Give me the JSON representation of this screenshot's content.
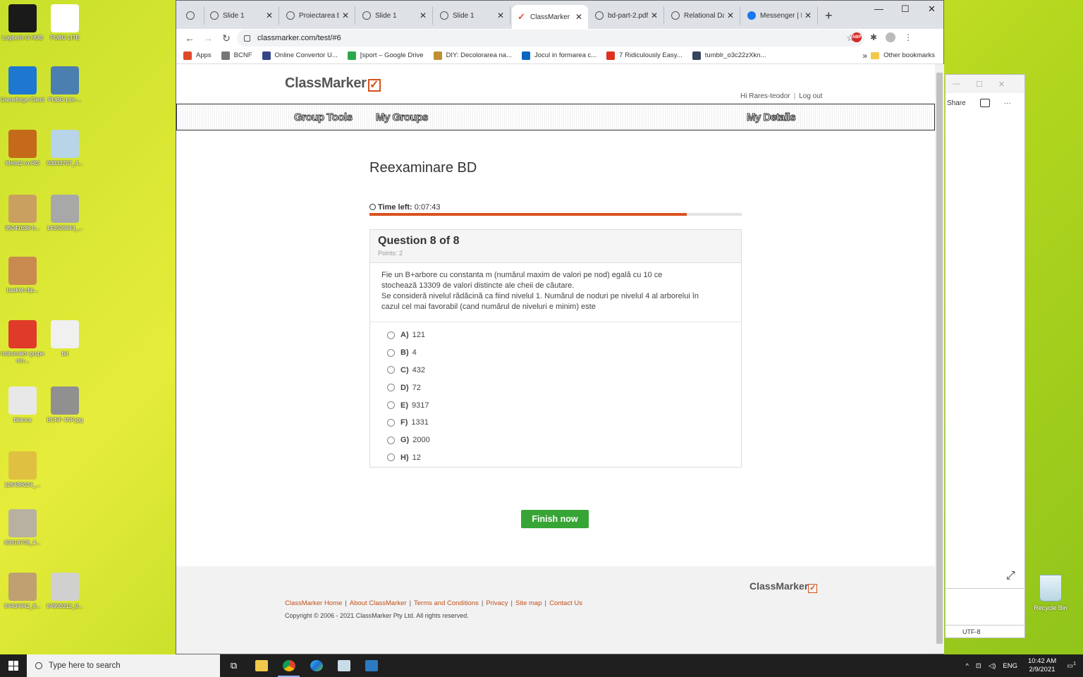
{
  "desktop": {
    "icons": [
      {
        "label": "Logitech G HUB",
        "color": "#1a1a1a"
      },
      {
        "label": "PUBG LITE",
        "color": "#ffffff"
      },
      {
        "label": "Gameforge Client",
        "color": "#1e78d2"
      },
      {
        "label": "PUBG-Lite-...",
        "color": "#4a7fb0"
      },
      {
        "label": "Metin2 ro-RO",
        "color": "#c46a1a"
      },
      {
        "label": "83933767_4...",
        "color": "#b8d4e8"
      },
      {
        "label": "95041636-h...",
        "color": "#c9a060"
      },
      {
        "label": "143509843_...",
        "color": "#a8a8a8"
      },
      {
        "label": "basket-clip...",
        "color": "#c98a50"
      },
      {
        "label": "",
        "color": "transparent"
      },
      {
        "label": "Indrumator grupe nm...",
        "color": "#e03a2a"
      },
      {
        "label": "bd",
        "color": "#f0f0f0"
      },
      {
        "label": "bilanca",
        "color": "#e8e8e8"
      },
      {
        "label": "BCNF 4NF.jpg",
        "color": "#909090"
      },
      {
        "label": "126486024_...",
        "color": "#e0c040"
      },
      {
        "label": "",
        "color": "transparent"
      },
      {
        "label": "83916708_4...",
        "color": "#b8b0a0"
      },
      {
        "label": "",
        "color": "transparent"
      },
      {
        "label": "84434842_8...",
        "color": "#c0a070"
      },
      {
        "label": "84950313_9...",
        "color": "#d0d0d0"
      }
    ],
    "recycle_bin": "Recycle Bin"
  },
  "side_window": {
    "share": "Share",
    "print_icon": "print-icon",
    "more": "···",
    "expand": "⤢",
    "encoding": "UTF-8"
  },
  "browser": {
    "tabs": [
      {
        "label": "",
        "icon": "globe-icon"
      },
      {
        "label": "Slide 1",
        "icon": "globe-icon"
      },
      {
        "label": "Proiectarea b",
        "icon": "globe-icon"
      },
      {
        "label": "Slide 1",
        "icon": "globe-icon"
      },
      {
        "label": "Slide 1",
        "icon": "globe-icon"
      },
      {
        "label": "ClassMarker",
        "icon": "classmarker-icon",
        "active": true
      },
      {
        "label": "bd-part-2.pdf",
        "icon": "globe-icon"
      },
      {
        "label": "Relational Da",
        "icon": "globe-icon"
      },
      {
        "label": "Messenger | F",
        "icon": "facebook-icon"
      }
    ],
    "new_tab": "+",
    "window_controls": {
      "minimize": "—",
      "maximize": "☐",
      "close": "✕"
    },
    "url": "classmarker.com/test/#6",
    "bookmarks": [
      {
        "label": "Apps",
        "color": "#e04a2a"
      },
      {
        "label": "BCNF",
        "color": "#777777"
      },
      {
        "label": "Online Convertor U...",
        "color": "#334488"
      },
      {
        "label": "[sport – Google Drive",
        "color": "#2aa84a"
      },
      {
        "label": "DIY: Decolorarea na...",
        "color": "#c09030"
      },
      {
        "label": "Jocul in formarea c...",
        "color": "#0a66c2"
      },
      {
        "label": "7 Ridiculously Easy...",
        "color": "#e03020"
      },
      {
        "label": "tumblr_o3c22zXkn...",
        "color": "#36465d"
      }
    ],
    "bookmarks_more": "»",
    "other_bookmarks": "Other bookmarks"
  },
  "page": {
    "logo": "ClassMarker",
    "greeting": "Hi Rares-teodor",
    "logout": "Log out",
    "nav": {
      "group_tools": "Group Tools",
      "my_groups": "My Groups",
      "my_details": "My Details"
    },
    "test_title": "Reexaminare BD",
    "time_label": "Time left:",
    "time_value": "0:07:43",
    "time_progress": 0.852,
    "question_title": "Question 8 of 8",
    "points": "Points: 2",
    "question_lines": [
      "Fie un B+arbore cu constanta m (numărul maxim de valori pe nod) egală cu 10 ce",
      "stochează 13309 de valori distincte ale cheii de căutare.",
      "Se consideră nivelul rădăcină ca fiind nivelul 1. Numărul de noduri pe nivelul 4 al arborelui în",
      "cazul cel mai favorabil (cand numărul de niveluri e minim) este"
    ],
    "answers": [
      {
        "letter": "A)",
        "value": "121"
      },
      {
        "letter": "B)",
        "value": "4"
      },
      {
        "letter": "C)",
        "value": "432"
      },
      {
        "letter": "D)",
        "value": "72"
      },
      {
        "letter": "E)",
        "value": "9317"
      },
      {
        "letter": "F)",
        "value": "1331"
      },
      {
        "letter": "G)",
        "value": "2000"
      },
      {
        "letter": "H)",
        "value": "12"
      }
    ],
    "finish_button": "Finish now",
    "footer": {
      "logo": "ClassMarker",
      "links": [
        "ClassMarker Home",
        "About ClassMarker",
        "Terms and Conditions",
        "Privacy",
        "Site map",
        "Contact Us"
      ],
      "copyright": "Copyright © 2006 - 2021 ClassMarker Pty Ltd. All rights reserved."
    }
  },
  "taskbar": {
    "search_placeholder": "Type here to search",
    "language": "ENG",
    "time": "10:42 AM",
    "date": "2/9/2021",
    "notification_count": "1"
  },
  "colors": {
    "accent": "#d9521f",
    "finish": "#37a536",
    "link": "#c0501a"
  }
}
